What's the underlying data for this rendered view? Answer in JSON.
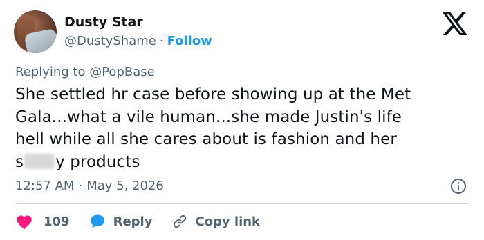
{
  "author": {
    "display_name": "Dusty Star",
    "handle": "@DustyShame",
    "separator": "·",
    "follow_label": "Follow"
  },
  "reply_context": {
    "prefix": "Replying to",
    "mention": "@PopBase"
  },
  "tweet": {
    "lines": [
      "She settled hr case before showing up at the Met",
      "Gala...what a vile human...she made Justin's life",
      "hell while all she cares about is fashion and her"
    ],
    "last_line_start": "s",
    "last_line_end": "y products"
  },
  "meta": {
    "time": "12:57 AM",
    "separator": "·",
    "date": "May 5, 2026"
  },
  "actions": {
    "like_count": "109",
    "reply_label": "Reply",
    "copy_link_label": "Copy link"
  },
  "colors": {
    "accent": "#1d9bf0",
    "like": "#f91880",
    "muted_text": "#536471",
    "primary_text": "#0f1419"
  },
  "icons": {
    "logo": "x-logo-icon",
    "info": "info-icon",
    "like": "heart-icon",
    "reply": "speech-bubble-icon",
    "copy": "link-icon"
  }
}
